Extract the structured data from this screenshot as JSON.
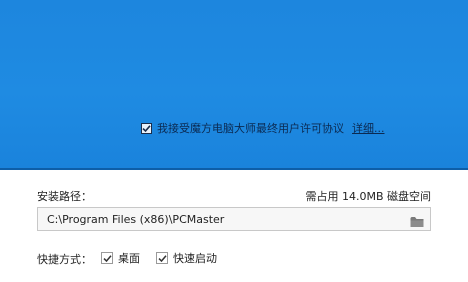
{
  "agreement": {
    "checked": true,
    "text": "我接受魔方电脑大师最终用户许可协议",
    "details_link": "详细..."
  },
  "install": {
    "path_label": "安装路径：",
    "space_required": "需占用 14.0MB 磁盘空间",
    "path_value": "C:\\Program Files (x86)\\PCMaster",
    "browse_icon": "folder-icon"
  },
  "shortcuts": {
    "label": "快捷方式：",
    "options": [
      {
        "label": "桌面",
        "checked": true
      },
      {
        "label": "快速启动",
        "checked": true
      }
    ]
  },
  "colors": {
    "banner_blue": "#1f8be2",
    "banner_edge": "#0d5ea8"
  }
}
